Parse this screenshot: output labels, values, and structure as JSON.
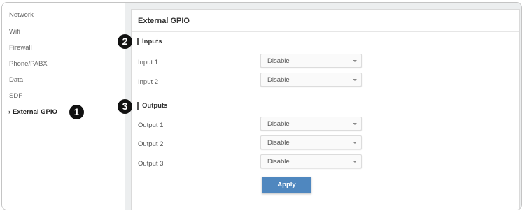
{
  "sidebar": {
    "items": [
      {
        "label": "Network"
      },
      {
        "label": "Wifi"
      },
      {
        "label": "Firewall"
      },
      {
        "label": "Phone/PABX"
      },
      {
        "label": "Data"
      },
      {
        "label": "SDF"
      },
      {
        "label": "External GPIO",
        "active": true
      }
    ],
    "active_chevron": "›"
  },
  "panel": {
    "title": "External GPIO",
    "inputs": {
      "heading": "Inputs",
      "rows": [
        {
          "label": "Input 1",
          "value": "Disable"
        },
        {
          "label": "Input 2",
          "value": "Disable"
        }
      ]
    },
    "outputs": {
      "heading": "Outputs",
      "rows": [
        {
          "label": "Output 1",
          "value": "Disable"
        },
        {
          "label": "Output 2",
          "value": "Disable"
        },
        {
          "label": "Output 3",
          "value": "Disable"
        }
      ]
    },
    "apply_label": "Apply"
  },
  "callouts": [
    "1",
    "2",
    "3"
  ],
  "colors": {
    "apply_button": "#4f87bf",
    "callout_badge": "#111111",
    "content_background": "#eceeef"
  },
  "icons": {
    "active_nav": "chevron-right-icon",
    "select_caret": "caret-down-icon"
  }
}
